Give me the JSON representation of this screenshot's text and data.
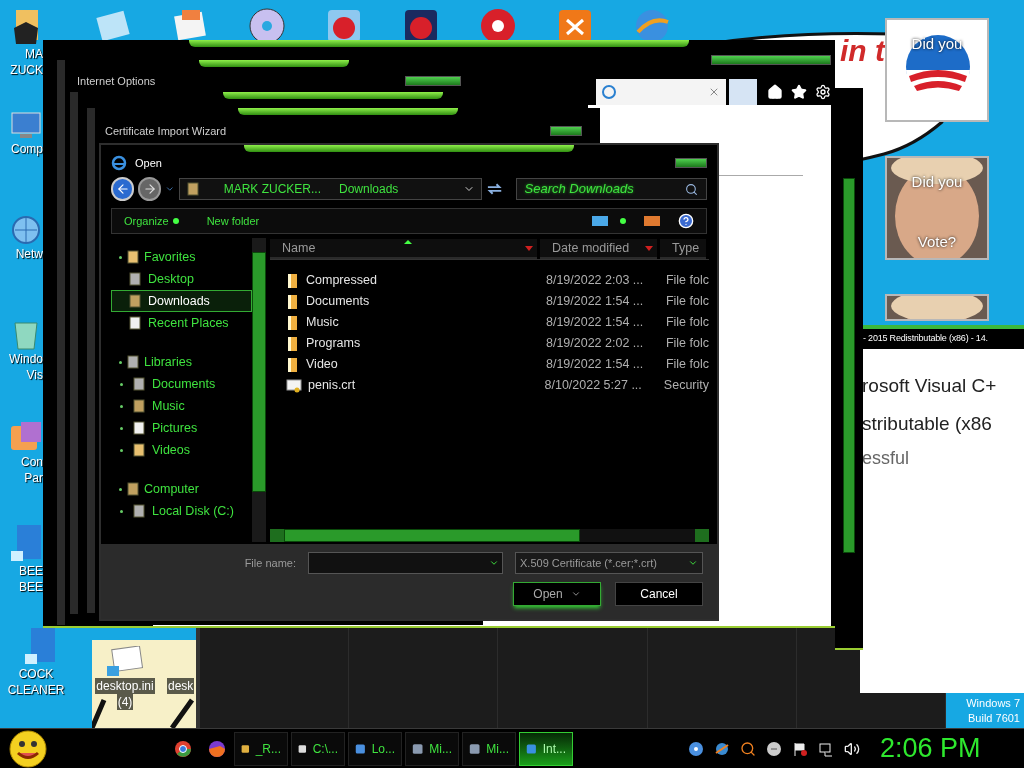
{
  "desktop_icons": [
    {
      "lines": [
        "MA",
        "ZUCK"
      ]
    },
    {
      "lines": [
        "Comp"
      ]
    },
    {
      "lines": [
        "Netw"
      ]
    },
    {
      "lines": [
        "Windo",
        "Vis"
      ]
    },
    {
      "lines": [
        "Con",
        "Par"
      ]
    },
    {
      "lines": [
        "BEE",
        "BEE"
      ]
    },
    {
      "lines": [
        "COCK",
        "CLEANER"
      ]
    }
  ],
  "bottom_icons": [
    {
      "lines": [
        "desktop.ini",
        "(4)"
      ]
    },
    {
      "lines": [
        "desk"
      ]
    }
  ],
  "cloud_text": "in t",
  "gadgets": [
    {
      "kind": "logo",
      "lines": [
        "Did you"
      ]
    },
    {
      "kind": "portrait",
      "lines": [
        "Did you",
        "Vote?"
      ]
    },
    {
      "kind": "portrait"
    }
  ],
  "internet_options": {
    "title": "Internet Options"
  },
  "cert_wizard": {
    "title": "Certificate Import Wizard"
  },
  "open_dialog": {
    "title": "Open",
    "breadcrumb": [
      "MARK ZUCKER...",
      "Downloads"
    ],
    "search": {
      "placeholder": "Search Downloads"
    },
    "toolbar": [
      "Organize",
      "New folder"
    ],
    "nav": [
      {
        "label": "Favorites",
        "selected": false,
        "children": [
          {
            "label": "Desktop",
            "selected": false
          },
          {
            "label": "Downloads",
            "selected": true
          },
          {
            "label": "Recent Places",
            "selected": false
          }
        ]
      },
      {
        "label": "Libraries",
        "selected": false,
        "children": [
          {
            "label": "Documents",
            "selected": false
          },
          {
            "label": "Music",
            "selected": false
          },
          {
            "label": "Pictures",
            "selected": false
          },
          {
            "label": "Videos",
            "selected": false
          }
        ]
      },
      {
        "label": "Computer",
        "selected": false,
        "children": [
          {
            "label": "Local Disk (C:)",
            "selected": false
          }
        ]
      }
    ],
    "columns": [
      {
        "label": "Name",
        "sorted": true
      },
      {
        "label": "Date modified",
        "sorted": false
      },
      {
        "label": "Type",
        "sorted": false
      }
    ],
    "files": [
      {
        "kind": "folder",
        "name": "Compressed",
        "date": "8/19/2022 2:03 ...",
        "type": "File folc"
      },
      {
        "kind": "folder",
        "name": "Documents",
        "date": "8/19/2022 1:54 ...",
        "type": "File folc"
      },
      {
        "kind": "folder",
        "name": "Music",
        "date": "8/19/2022 1:54 ...",
        "type": "File folc"
      },
      {
        "kind": "folder",
        "name": "Programs",
        "date": "8/19/2022 2:02 ...",
        "type": "File folc"
      },
      {
        "kind": "folder",
        "name": "Video",
        "date": "8/19/2022 1:54 ...",
        "type": "File folc"
      },
      {
        "kind": "certificate",
        "name": "penis.crt",
        "date": "8/10/2022 5:27 ...",
        "type": "Security"
      }
    ],
    "file_name_label": "File name:",
    "file_type": "X.509 Certificate (*.cer;*.crt)",
    "buttons": [
      {
        "kind": "split",
        "label": "Open"
      },
      {
        "kind": "plain",
        "label": "Cancel"
      }
    ]
  },
  "installer": {
    "title": "- 2015 Redistributable (x86) - 14.",
    "lines": [
      "rosoft Visual C+",
      "stributable (x86"
    ],
    "status": "essful"
  },
  "watermark": [
    "Windows 7",
    "Build 7601"
  ],
  "taskbar": {
    "items": [
      {
        "label": "_R...",
        "selected": false
      },
      {
        "label": "C:\\...",
        "selected": false
      },
      {
        "label": "Lo...",
        "selected": false
      },
      {
        "label": "Mi...",
        "selected": false
      },
      {
        "label": "Mi...",
        "selected": false
      },
      {
        "label": "Int...",
        "selected": true
      }
    ],
    "clock": "2:06 PM"
  }
}
